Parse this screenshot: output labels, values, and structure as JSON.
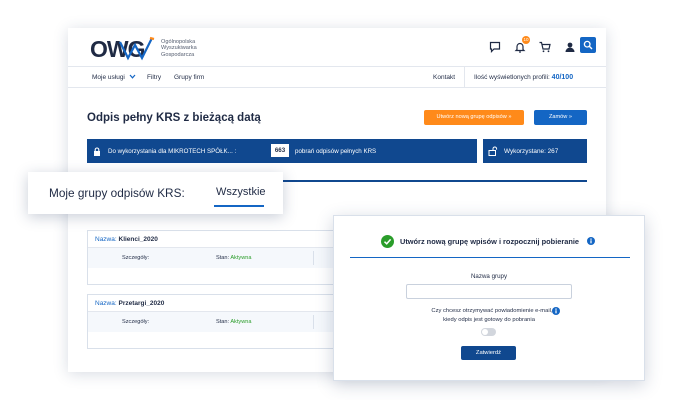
{
  "brand": {
    "logo_text": "OWG",
    "tagline": [
      "Ogólnopolska",
      "Wyszukiwarka",
      "Gospodarcza"
    ],
    "logo_colors": [
      "#1f2a44",
      "#1466c4",
      "#ff8a1a"
    ]
  },
  "header": {
    "icons": [
      "chat-icon",
      "bell-icon",
      "cart-icon",
      "user-icon",
      "search-icon"
    ],
    "notification_badge": "10"
  },
  "nav": {
    "services": "Moje usługi",
    "filters": "Filtry",
    "company_groups": "Grupy firm",
    "contact": "Kontakt",
    "profile_count_label": "Ilość wyświetlonych profili:",
    "profile_count_value": "40/100"
  },
  "page": {
    "title": "Odpis pełny KRS z bieżącą datą",
    "create_group_button": "Utwórz nową grupę odpisów »",
    "order_button": "Zamów »"
  },
  "availability": {
    "text": "Do wykorzystania dla MIKROTECH SPÓŁK... :",
    "count": "663",
    "suffix": "pobrań odpisów pełnych KRS",
    "used_label": "Wykorzystane: 267"
  },
  "tabs": {
    "title": "Moje grupy odpisów KRS:",
    "active": "Wszystkie"
  },
  "groups": [
    {
      "name_label": "Nazwa:",
      "name": "Klienci_2020",
      "details_label": "Szczegóły:",
      "status_label": "Stan:",
      "status": "Aktywna"
    },
    {
      "name_label": "Nazwa:",
      "name": "Przetargi_2020",
      "details_label": "Szczegóły:",
      "status_label": "Stan:",
      "status": "Aktywna"
    }
  ],
  "modal": {
    "title": "Utwórz nową grupę wpisów i rozpocznij pobieranie",
    "field_label": "Nazwa grupy",
    "field_value": "",
    "notify_line1": "Czy chcesz otrzymywać powiadomienie e-mail,",
    "notify_line2": "kiedy odpis jest gotowy do pobrania",
    "toggle_on": false,
    "submit": "Zatwierdź"
  },
  "colors": {
    "primary": "#1466c4",
    "dark_blue": "#10488f",
    "accent": "#ff8a1a",
    "success": "#2a9d2a"
  }
}
